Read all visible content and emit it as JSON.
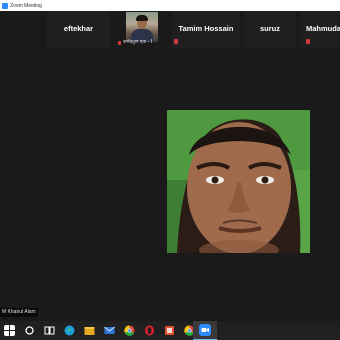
{
  "window": {
    "title": "Zoom Meeting"
  },
  "participants": [
    {
      "name": "eftekhar",
      "muted": false
    },
    {
      "name": "কারিমুল হক - I",
      "muted": true,
      "has_video": true
    },
    {
      "name": "Tamim Hossain",
      "muted": true
    },
    {
      "name": "suruz",
      "muted": false
    },
    {
      "name": "Mahmuda",
      "muted": true
    }
  ],
  "main_speaker": {
    "name": "M Khairul Alam"
  },
  "taskbar": {
    "icons": [
      "windows-start-icon",
      "search-icon",
      "task-view-icon",
      "edge-icon",
      "file-explorer-icon",
      "mail-icon",
      "chrome-icon",
      "opera-icon",
      "office-icon",
      "chrome-icon",
      "zoom-icon"
    ]
  },
  "colors": {
    "background": "#1a1a1a",
    "muted": "#d63b3b",
    "zoom_blue": "#2d8cff"
  }
}
